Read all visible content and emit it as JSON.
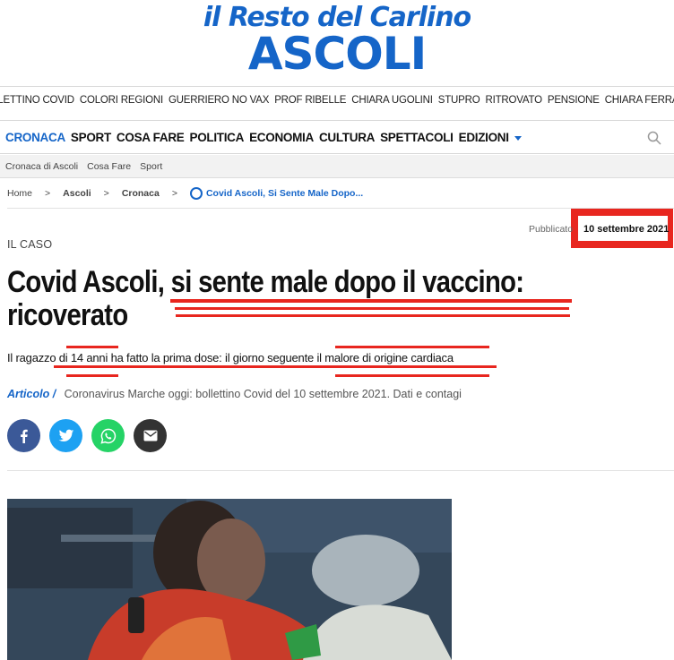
{
  "brand": {
    "name": "il Resto del Carlino",
    "city": "ASCOLI"
  },
  "tags": [
    "BOLLETTINO COVID",
    "COLORI REGIONI",
    "GUERRIERO NO VAX",
    "PROF RIBELLE",
    "CHIARA UGOLINI",
    "STUPRO",
    "RITROVATO",
    "PENSIONE",
    "CHIARA FERRAGNI"
  ],
  "nav": [
    "CRONACA",
    "SPORT",
    "COSA FARE",
    "POLITICA",
    "ECONOMIA",
    "CULTURA",
    "SPETTACOLI",
    "EDIZIONI"
  ],
  "subnav": [
    "Cronaca di Ascoli",
    "Cosa Fare",
    "Sport"
  ],
  "breadcrumb": {
    "home": "Home",
    "city": "Ascoli",
    "section": "Cronaca",
    "current": "Covid Ascoli, Si Sente Male Dopo..."
  },
  "published": {
    "label": "Pubblicato",
    "date": "10 settembre 2021"
  },
  "article": {
    "kicker": "IL CASO",
    "title_line1_a": "Covid Ascoli",
    "title_line1_b": ", si sente male dopo il vaccino:",
    "title_line2": "ricoverato",
    "subtitle": "Il ragazzo di 14 anni ha fatto la prima dose: il giorno seguente il malore di origine cardiaca",
    "type": "Articolo /",
    "related": "Coronavirus Marche oggi: bollettino Covid del 10 settembre 2021. Dati e contagi"
  },
  "share": [
    "facebook-icon",
    "twitter-icon",
    "whatsapp-icon",
    "email-icon"
  ],
  "colors": {
    "brand": "#1565c8",
    "highlight": "#e8261f"
  }
}
